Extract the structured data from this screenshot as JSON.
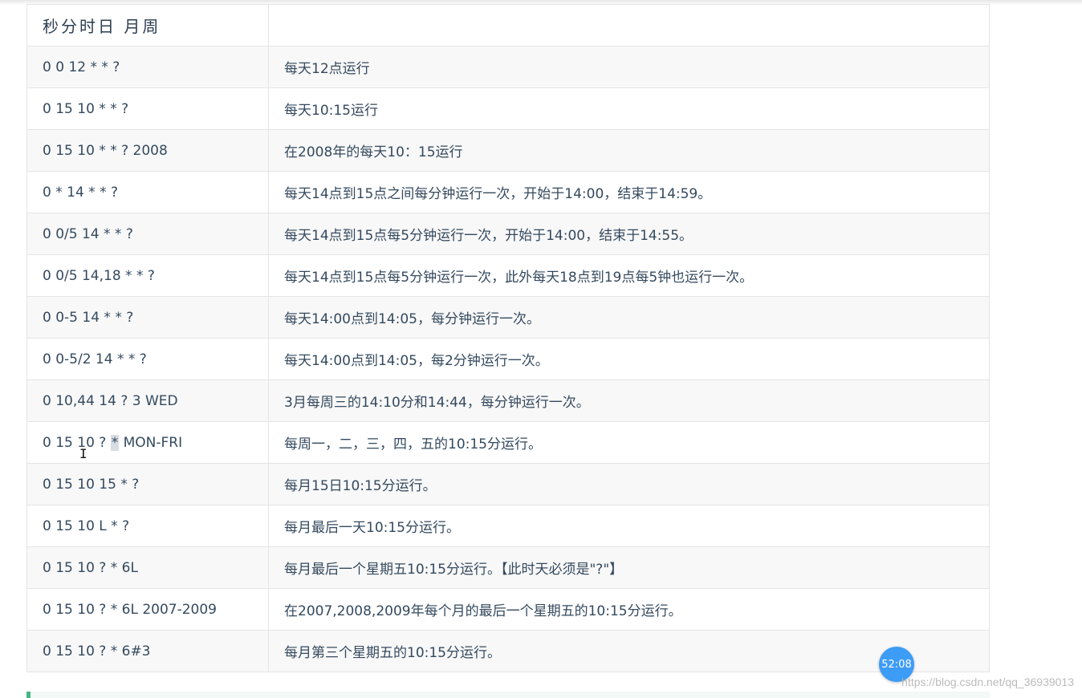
{
  "table": {
    "header": {
      "expression": "秒分时日 月周",
      "description": ""
    },
    "rows": [
      {
        "expression": "0 0 12 * * ?",
        "description": "每天12点运行"
      },
      {
        "expression": "0 15 10 * * ?",
        "description": "每天10:15运行"
      },
      {
        "expression": "0 15 10 * * ? 2008",
        "description": "在2008年的每天10：15运行"
      },
      {
        "expression": "0 * 14 * * ?",
        "description": "每天14点到15点之间每分钟运行一次，开始于14:00，结束于14:59。"
      },
      {
        "expression": "0 0/5 14 * * ?",
        "description": "每天14点到15点每5分钟运行一次，开始于14:00，结束于14:55。"
      },
      {
        "expression": "0 0/5 14,18 * * ?",
        "description": "每天14点到15点每5分钟运行一次，此外每天18点到19点每5钟也运行一次。"
      },
      {
        "expression": "0 0-5 14 * * ?",
        "description": "每天14:00点到14:05，每分钟运行一次。"
      },
      {
        "expression": "0 0-5/2 14 * * ?",
        "description": "每天14:00点到14:05，每2分钟运行一次。"
      },
      {
        "expression": "0 10,44 14 ? 3 WED",
        "description": "3月每周三的14:10分和14:44，每分钟运行一次。"
      },
      {
        "expression_before": "0 15 10 ? ",
        "expression_selected": "*",
        "expression_after": " MON-FRI",
        "description": "每周一，二，三，四，五的10:15分运行。"
      },
      {
        "expression": "0 15 10 15 * ?",
        "description": "每月15日10:15分运行。"
      },
      {
        "expression": "0 15 10 L * ?",
        "description": "每月最后一天10:15分运行。"
      },
      {
        "expression": "0 15 10 ? * 6L",
        "description": "每月最后一个星期五10:15分运行。【此时天必须是\"?\"】"
      },
      {
        "expression": "0 15 10 ? * 6L 2007-2009",
        "description": "在2007,2008,2009年每个月的最后一个星期五的10:15分运行。"
      },
      {
        "expression": "0 15 10 ? * 6#3",
        "description": "每月第三个星期五的10:15分运行。"
      }
    ]
  },
  "timer": {
    "label": "52:08"
  },
  "watermark": {
    "text": "https://blog.csdn.net/qq_36939013"
  }
}
